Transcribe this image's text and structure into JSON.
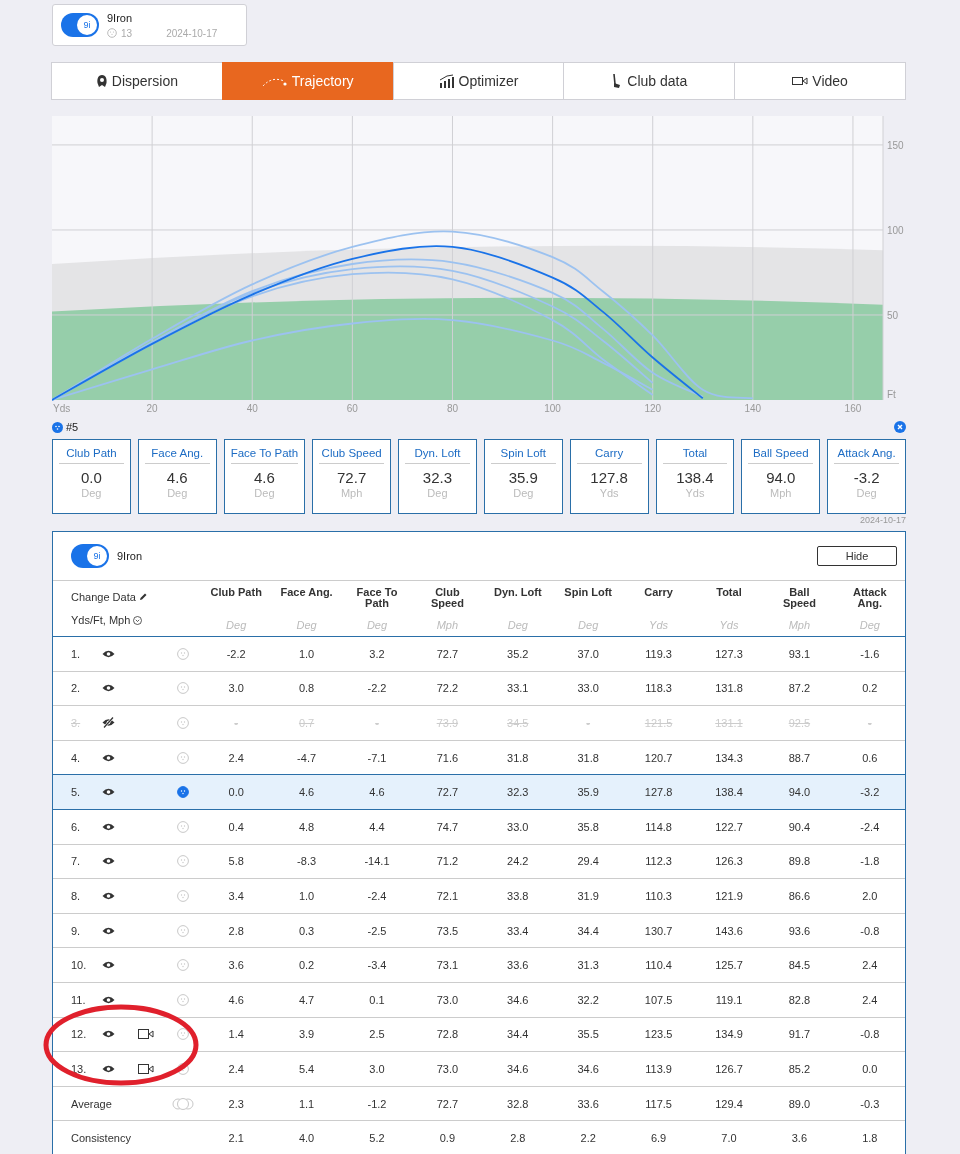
{
  "club_card": {
    "badge": "9i",
    "toggle_on": true,
    "name": "9Iron",
    "shots": "13",
    "date": "2024-10-17"
  },
  "tabs": [
    {
      "label": "Dispersion",
      "kind": "dispersion",
      "selected": false
    },
    {
      "label": "Trajectory",
      "kind": "trajectory",
      "selected": true
    },
    {
      "label": "Optimizer",
      "kind": "optimizer",
      "selected": false
    },
    {
      "label": "Club data",
      "kind": "club",
      "selected": false
    },
    {
      "label": "Video",
      "kind": "video",
      "selected": false
    }
  ],
  "trajectory_chart": {
    "chart_data": {
      "type": "line",
      "xlabel": "Yds",
      "ylabel": "Ft",
      "x": [
        0,
        20,
        40,
        60,
        80,
        100,
        110,
        120,
        130,
        140
      ],
      "xlim": [
        0,
        166
      ],
      "ylim": [
        0,
        167
      ],
      "xticks": [
        20,
        40,
        60,
        80,
        100,
        120,
        140,
        160
      ],
      "yticks": [
        50,
        100,
        150
      ],
      "grid": true,
      "series": [
        {
          "color": "#9cc2f0",
          "values": [
            0,
            36,
            68,
            90,
            99,
            84,
            64,
            38,
            6,
            1
          ]
        },
        {
          "color": "#9cc2f0",
          "values": [
            0,
            34,
            64,
            80,
            81,
            63,
            42,
            16,
            2,
            null
          ]
        },
        {
          "color": "#9cc2f0",
          "values": [
            0,
            34,
            63,
            77,
            76,
            55,
            35,
            10,
            null,
            null
          ]
        },
        {
          "color": "#9cc2f0",
          "values": [
            0,
            33,
            61,
            74,
            71,
            47,
            24,
            3,
            null,
            null
          ]
        },
        {
          "color": "#9cc2f0",
          "values": [
            0,
            18,
            35,
            45,
            47,
            35,
            22,
            6,
            null,
            null
          ]
        },
        {
          "color": "#1a73e8",
          "values": [
            0,
            33,
            62,
            83,
            90,
            72,
            52,
            25,
            1,
            null
          ]
        }
      ]
    }
  },
  "shot_panel": {
    "title": "#5",
    "metrics": [
      {
        "label": "Club Path",
        "value": "0.0",
        "unit": "Deg"
      },
      {
        "label": "Face Ang.",
        "value": "4.6",
        "unit": "Deg"
      },
      {
        "label": "Face To Path",
        "value": "4.6",
        "unit": "Deg"
      },
      {
        "label": "Club Speed",
        "value": "72.7",
        "unit": "Mph"
      },
      {
        "label": "Dyn. Loft",
        "value": "32.3",
        "unit": "Deg"
      },
      {
        "label": "Spin Loft",
        "value": "35.9",
        "unit": "Deg"
      },
      {
        "label": "Carry",
        "value": "127.8",
        "unit": "Yds"
      },
      {
        "label": "Total",
        "value": "138.4",
        "unit": "Yds"
      },
      {
        "label": "Ball Speed",
        "value": "94.0",
        "unit": "Mph"
      },
      {
        "label": "Attack Ang.",
        "value": "-3.2",
        "unit": "Deg"
      }
    ],
    "date": "2024-10-17"
  },
  "table": {
    "badge": "9i",
    "toggle_on": true,
    "name": "9Iron",
    "hide_button": "Hide",
    "change_data": "Change Data",
    "units_label": "Yds/Ft, Mph",
    "columns": [
      {
        "label": "Club Path",
        "unit": "Deg"
      },
      {
        "label": "Face Ang.",
        "unit": "Deg"
      },
      {
        "label": "Face To Path",
        "unit": "Deg"
      },
      {
        "label": "Club Speed",
        "unit": "Mph"
      },
      {
        "label": "Dyn. Loft",
        "unit": "Deg"
      },
      {
        "label": "Spin Loft",
        "unit": "Deg"
      },
      {
        "label": "Carry",
        "unit": "Yds"
      },
      {
        "label": "Total",
        "unit": "Yds"
      },
      {
        "label": "Ball Speed",
        "unit": "Mph"
      },
      {
        "label": "Attack Ang.",
        "unit": "Deg"
      }
    ],
    "rows": [
      {
        "number": "1.",
        "visible": true,
        "video": false,
        "selected": false,
        "values": [
          "-2.2",
          "1.0",
          "3.2",
          "72.7",
          "35.2",
          "37.0",
          "119.3",
          "127.3",
          "93.1",
          "-1.6"
        ]
      },
      {
        "number": "2.",
        "visible": true,
        "video": false,
        "selected": false,
        "values": [
          "3.0",
          "0.8",
          "-2.2",
          "72.2",
          "33.1",
          "33.0",
          "118.3",
          "131.8",
          "87.2",
          "0.2"
        ]
      },
      {
        "number": "3.",
        "visible": false,
        "video": false,
        "selected": false,
        "values": [
          "-",
          "0.7",
          "-",
          "73.9",
          "34.5",
          "-",
          "121.5",
          "131.1",
          "92.5",
          "-"
        ]
      },
      {
        "number": "4.",
        "visible": true,
        "video": false,
        "selected": false,
        "values": [
          "2.4",
          "-4.7",
          "-7.1",
          "71.6",
          "31.8",
          "31.8",
          "120.7",
          "134.3",
          "88.7",
          "0.6"
        ]
      },
      {
        "number": "5.",
        "visible": true,
        "video": false,
        "selected": true,
        "values": [
          "0.0",
          "4.6",
          "4.6",
          "72.7",
          "32.3",
          "35.9",
          "127.8",
          "138.4",
          "94.0",
          "-3.2"
        ]
      },
      {
        "number": "6.",
        "visible": true,
        "video": false,
        "selected": false,
        "values": [
          "0.4",
          "4.8",
          "4.4",
          "74.7",
          "33.0",
          "35.8",
          "114.8",
          "122.7",
          "90.4",
          "-2.4"
        ]
      },
      {
        "number": "7.",
        "visible": true,
        "video": false,
        "selected": false,
        "values": [
          "5.8",
          "-8.3",
          "-14.1",
          "71.2",
          "24.2",
          "29.4",
          "112.3",
          "126.3",
          "89.8",
          "-1.8"
        ]
      },
      {
        "number": "8.",
        "visible": true,
        "video": false,
        "selected": false,
        "values": [
          "3.4",
          "1.0",
          "-2.4",
          "72.1",
          "33.8",
          "31.9",
          "110.3",
          "121.9",
          "86.6",
          "2.0"
        ]
      },
      {
        "number": "9.",
        "visible": true,
        "video": false,
        "selected": false,
        "values": [
          "2.8",
          "0.3",
          "-2.5",
          "73.5",
          "33.4",
          "34.4",
          "130.7",
          "143.6",
          "93.6",
          "-0.8"
        ]
      },
      {
        "number": "10.",
        "visible": true,
        "video": false,
        "selected": false,
        "values": [
          "3.6",
          "0.2",
          "-3.4",
          "73.1",
          "33.6",
          "31.3",
          "110.4",
          "125.7",
          "84.5",
          "2.4"
        ]
      },
      {
        "number": "11.",
        "visible": true,
        "video": false,
        "selected": false,
        "values": [
          "4.6",
          "4.7",
          "0.1",
          "73.0",
          "34.6",
          "32.2",
          "107.5",
          "119.1",
          "82.8",
          "2.4"
        ]
      },
      {
        "number": "12.",
        "visible": true,
        "video": true,
        "selected": false,
        "values": [
          "1.4",
          "3.9",
          "2.5",
          "72.8",
          "34.4",
          "35.5",
          "123.5",
          "134.9",
          "91.7",
          "-0.8"
        ]
      },
      {
        "number": "13.",
        "visible": true,
        "video": true,
        "selected": false,
        "values": [
          "2.4",
          "5.4",
          "3.0",
          "73.0",
          "34.6",
          "34.6",
          "113.9",
          "126.7",
          "85.2",
          "0.0"
        ]
      }
    ],
    "summary": [
      {
        "label": "Average",
        "kind": "average",
        "values": [
          "2.3",
          "1.1",
          "-1.2",
          "72.7",
          "32.8",
          "33.6",
          "117.5",
          "129.4",
          "89.0",
          "-0.3"
        ]
      },
      {
        "label": "Consistency",
        "kind": "consistency",
        "values": [
          "2.1",
          "4.0",
          "5.2",
          "0.9",
          "2.8",
          "2.2",
          "6.9",
          "7.0",
          "3.6",
          "1.8"
        ]
      }
    ]
  }
}
